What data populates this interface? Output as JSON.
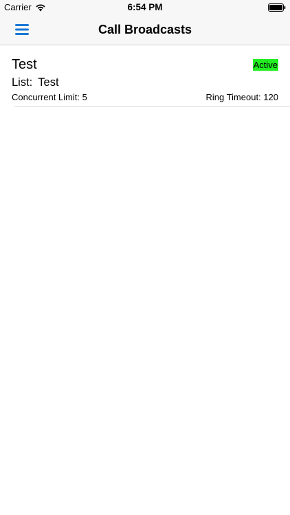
{
  "status_bar": {
    "carrier": "Carrier",
    "time": "6:54 PM",
    "icons": [
      "wifi-icon",
      "battery-icon"
    ]
  },
  "nav": {
    "title": "Call Broadcasts",
    "menu_icon": "hamburger-menu-icon",
    "accent_color": "#1a78d6"
  },
  "broadcasts": [
    {
      "title": "Test",
      "status": "Active",
      "status_color": "#22ee22",
      "list_label": "List:",
      "list_name": "Test",
      "concurrent_limit_label": "Concurrent Limit:",
      "concurrent_limit": "5",
      "ring_timeout_label": "Ring Timeout:",
      "ring_timeout": "120"
    }
  ]
}
